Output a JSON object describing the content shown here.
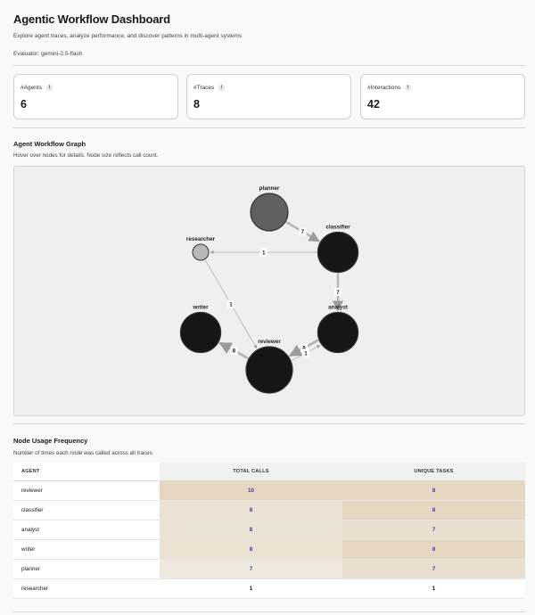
{
  "header": {
    "title": "Agentic Workflow Dashboard",
    "subtitle": "Explore agent traces, analyze performance, and discover patterns in multi-agent systems",
    "evaluator": "Evaluator: gemini-2.5-flash"
  },
  "cards": [
    {
      "label": "#Agents",
      "value": "6"
    },
    {
      "label": "#Traces",
      "value": "8"
    },
    {
      "label": "#Interactions",
      "value": "42"
    }
  ],
  "graph": {
    "title": "Agent Workflow Graph",
    "subtitle": "Hover over nodes for details. Node size reflects call count.",
    "nodes": [
      {
        "id": "planner",
        "label": "planner",
        "calls": 7,
        "color": "#606060"
      },
      {
        "id": "classifier",
        "label": "classifier",
        "calls": 8,
        "color": "#161616"
      },
      {
        "id": "researcher",
        "label": "researcher",
        "calls": 1,
        "color": "#b8b8b8"
      },
      {
        "id": "writer",
        "label": "writer",
        "calls": 8,
        "color": "#161616"
      },
      {
        "id": "analyst",
        "label": "analyst",
        "calls": 8,
        "color": "#161616"
      },
      {
        "id": "reviewer",
        "label": "reviewer",
        "calls": 10,
        "color": "#161616"
      }
    ],
    "edges": [
      {
        "from": "planner",
        "to": "classifier",
        "weight": "7"
      },
      {
        "from": "classifier",
        "to": "researcher",
        "weight": "1"
      },
      {
        "from": "classifier",
        "to": "analyst",
        "weight": "7"
      },
      {
        "from": "researcher",
        "to": "reviewer",
        "weight": "1"
      },
      {
        "from": "reviewer",
        "to": "writer",
        "weight": "8"
      },
      {
        "from": "analyst",
        "to": "reviewer",
        "weight": "8"
      },
      {
        "from": "reviewer",
        "to": "analyst",
        "weight": "1"
      }
    ]
  },
  "usage": {
    "title": "Node Usage Frequency",
    "subtitle": "Number of times each node was called across all traces",
    "headers": [
      "AGENT",
      "TOTAL CALLS",
      "UNIQUE TASKS"
    ],
    "rows": [
      {
        "agent": "reviewer",
        "total_calls": "10",
        "unique_tasks": "8",
        "total_bg": "#e4d6c1",
        "tasks_bg": "#e4d6c1"
      },
      {
        "agent": "classifier",
        "total_calls": "8",
        "unique_tasks": "8",
        "total_bg": "#ebe2d4",
        "tasks_bg": "#e4d6c1"
      },
      {
        "agent": "analyst",
        "total_calls": "8",
        "unique_tasks": "7",
        "total_bg": "#ebe2d4",
        "tasks_bg": "#e9dfd0"
      },
      {
        "agent": "writer",
        "total_calls": "8",
        "unique_tasks": "8",
        "total_bg": "#ebe2d4",
        "tasks_bg": "#e4d6c1"
      },
      {
        "agent": "planner",
        "total_calls": "7",
        "unique_tasks": "7",
        "total_bg": "#efe8de",
        "tasks_bg": "#e9dfd0"
      },
      {
        "agent": "researcher",
        "total_calls": "1",
        "unique_tasks": "1",
        "total_bg": "#ffffff",
        "tasks_bg": "#ffffff"
      }
    ]
  }
}
